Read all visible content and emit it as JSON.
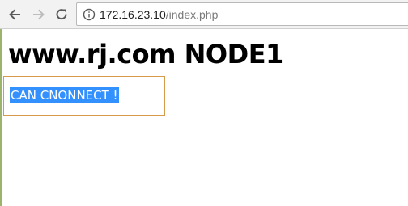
{
  "browser": {
    "address_bar": {
      "host": "172.16.23.10",
      "path": "/index.php"
    },
    "icons": {
      "back": "back-arrow-icon",
      "forward": "forward-arrow-icon",
      "reload": "reload-icon",
      "info": "info-icon"
    }
  },
  "page": {
    "title": "www.rj.com NODE1",
    "message": "CAN CNONNECT !"
  },
  "colors": {
    "selection": "#3390ff",
    "box_border": "#d69a4a"
  }
}
